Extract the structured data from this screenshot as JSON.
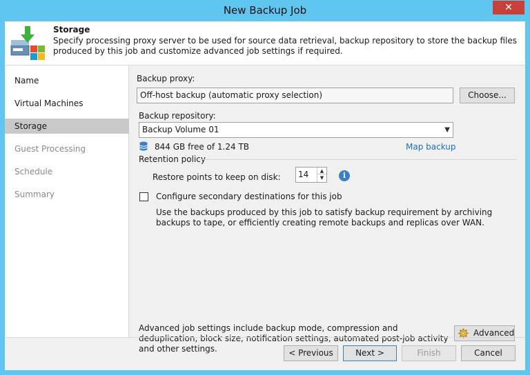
{
  "window": {
    "title": "New Backup Job",
    "close_glyph": "✕"
  },
  "header": {
    "title": "Storage",
    "description": "Specify processing proxy server to be used for source data retrieval, backup repository to store the backup files produced by this job and customize advanced job settings if required.",
    "icon": "backup-job-storage-icon"
  },
  "sidebar": {
    "items": [
      {
        "label": "Name",
        "state": "normal"
      },
      {
        "label": "Virtual Machines",
        "state": "normal"
      },
      {
        "label": "Storage",
        "state": "active"
      },
      {
        "label": "Guest Processing",
        "state": "disabled"
      },
      {
        "label": "Schedule",
        "state": "disabled"
      },
      {
        "label": "Summary",
        "state": "disabled"
      }
    ]
  },
  "main": {
    "backup_proxy_label": "Backup proxy:",
    "backup_proxy_value": "Off-host backup (automatic proxy selection)",
    "choose_label": "Choose...",
    "backup_repository_label": "Backup repository:",
    "backup_repository_value": "Backup Volume 01",
    "free_space": "844 GB free of 1.24 TB",
    "map_backup_label": "Map backup",
    "retention_policy_label": "Retention policy",
    "restore_points_label": "Restore points to keep on disk:",
    "restore_points_value": "14",
    "secondary_checkbox_label": "Configure secondary destinations for this job",
    "secondary_checked": false,
    "secondary_description": "Use the backups produced by this job to satisfy backup requirement by archiving backups to tape, or efficiently creating remote backups and replicas over WAN.",
    "advanced_description": "Advanced job settings include backup mode, compression and deduplication, block size, notification settings, automated post-job activity and other settings.",
    "advanced_label": "Advanced"
  },
  "footer": {
    "previous_label": "< Previous",
    "next_label": "Next >",
    "finish_label": "Finish",
    "cancel_label": "Cancel"
  },
  "colors": {
    "titlebar": "#5fc6f0",
    "close_button": "#c7403a",
    "link": "#1d6ec5",
    "active_nav": "#c8c8c8"
  }
}
